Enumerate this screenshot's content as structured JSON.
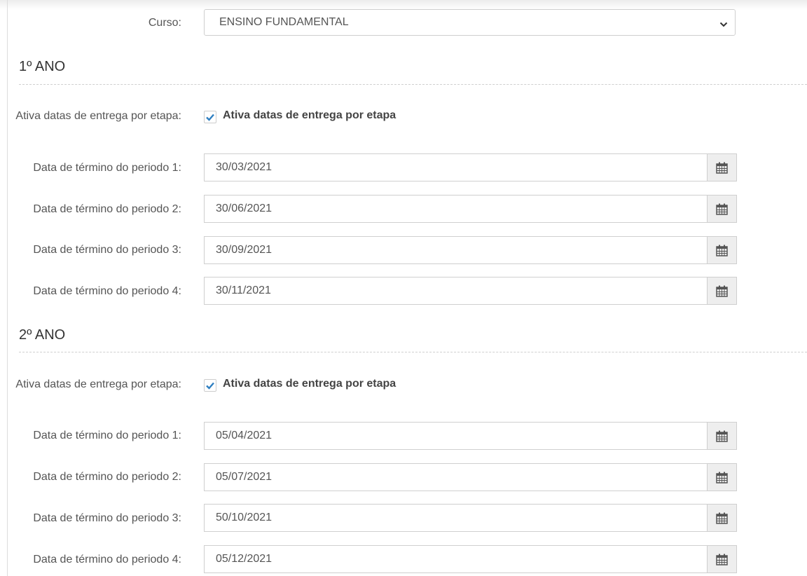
{
  "curso": {
    "label": "Curso:",
    "selected": "ENSINO FUNDAMENTAL"
  },
  "sections": [
    {
      "title": "1º ANO",
      "toggle": {
        "label": "Ativa datas de entrega por etapa:",
        "checkbox_label": "Ativa datas de entrega por etapa",
        "checked": true
      },
      "periods": [
        {
          "label": "Data de término do periodo 1:",
          "value": "30/03/2021"
        },
        {
          "label": "Data de término do periodo 2:",
          "value": "30/06/2021"
        },
        {
          "label": "Data de término do periodo 3:",
          "value": "30/09/2021"
        },
        {
          "label": "Data de término do periodo 4:",
          "value": "30/11/2021"
        }
      ]
    },
    {
      "title": "2º ANO",
      "toggle": {
        "label": "Ativa datas de entrega por etapa:",
        "checkbox_label": "Ativa datas de entrega por etapa",
        "checked": true
      },
      "periods": [
        {
          "label": "Data de término do periodo 1:",
          "value": "05/04/2021"
        },
        {
          "label": "Data de término do periodo 2:",
          "value": "05/07/2021"
        },
        {
          "label": "Data de término do periodo 3:",
          "value": "50/10/2021"
        },
        {
          "label": "Data de término do periodo 4:",
          "value": "05/12/2021"
        }
      ]
    }
  ],
  "icons": {
    "calendar": "calendar-icon",
    "check": "checkmark-icon",
    "dropdown": "chevron-down-icon"
  },
  "colors": {
    "check_accent": "#2f7fc1",
    "addon_bg": "#eeeeee",
    "border": "#cfcfcf"
  }
}
